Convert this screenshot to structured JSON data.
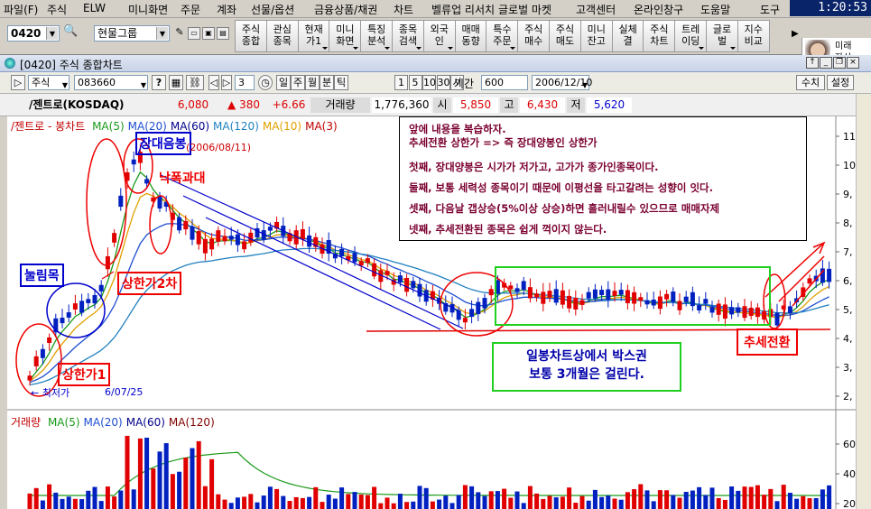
{
  "menubar": {
    "items": [
      "파일(F)",
      "주식",
      "ELW",
      "미니화면",
      "주문",
      "계좌",
      "선물/옵션",
      "금융상품/채권",
      "차트",
      "벨류업 리서치",
      "글로벌 마켓",
      "고객센터",
      "온라인창구",
      "도움말",
      "도구"
    ],
    "clock": "1:20:53"
  },
  "toolbar": {
    "screen_no": "0420",
    "group": "현물그룹",
    "buttons": [
      {
        "label": "주식\n종합",
        "dd": false
      },
      {
        "label": "관심\n종목",
        "dd": false
      },
      {
        "label": "현재\n가1",
        "dd": true
      },
      {
        "label": "미니\n화면",
        "dd": true
      },
      {
        "label": "특징\n분석",
        "dd": true
      },
      {
        "label": "종목\n검색",
        "dd": true
      },
      {
        "label": "외국\n인",
        "dd": true
      },
      {
        "label": "매매\n동향",
        "dd": false
      },
      {
        "label": "특수\n주문",
        "dd": true
      },
      {
        "label": "주식\n매수",
        "dd": false
      },
      {
        "label": "주식\n매도",
        "dd": false
      },
      {
        "label": "미니\n잔고",
        "dd": false
      },
      {
        "label": "실체\n결",
        "dd": false
      },
      {
        "label": "주식\n차트",
        "dd": false
      },
      {
        "label": "트레\n이딩",
        "dd": true
      },
      {
        "label": "글로\n벌",
        "dd": true
      },
      {
        "label": "지수\n비교",
        "dd": false
      }
    ],
    "profile_text": "미래\n자산"
  },
  "window": {
    "title": "[0420] 주식 종합차트"
  },
  "controls": {
    "market": "주식",
    "code": "083660",
    "count": "3",
    "periods": [
      "일",
      "주",
      "월",
      "분",
      "틱"
    ],
    "quick": [
      "1",
      "5",
      "10",
      "30",
      "시"
    ],
    "period_label": "기간",
    "period_value": "600",
    "date": "2006/12/10",
    "btn_manual": "수치",
    "btn_settings": "설정"
  },
  "quote": {
    "name": "/젠트로(KOSDAQ)",
    "price": "6,080",
    "change": "▲ 380",
    "pct": "+6.66",
    "vol_label": "거래량",
    "volume": "1,776,360",
    "open_label": "시",
    "open": "5,850",
    "high_label": "고",
    "high": "6,430",
    "low_label": "저",
    "low": "5,620"
  },
  "chart": {
    "legend_main": "/젠트로 - 봉차트",
    "ma_labels": [
      {
        "text": "MA(5)",
        "color": "#1a9a1a"
      },
      {
        "text": "MA(20)",
        "color": "#1f4fd0"
      },
      {
        "text": "MA(60)",
        "color": "#00008b"
      },
      {
        "text": "MA(120)",
        "color": "#2080c0"
      },
      {
        "text": "MA(10)",
        "color": "#e0a000"
      },
      {
        "text": "MA(3)",
        "color": "#c00000"
      }
    ],
    "volume_legend": "거래량",
    "volume_ma": [
      {
        "text": "MA(5)",
        "color": "#1a9a1a"
      },
      {
        "text": "MA(20)",
        "color": "#1f4fd0"
      },
      {
        "text": "MA(60)",
        "color": "#00008b"
      },
      {
        "text": "MA(120)",
        "color": "#800000"
      }
    ],
    "y_ticks": [
      "11",
      "10",
      "9,",
      "8,",
      "7,",
      "6,",
      "5,",
      "4,",
      "3,",
      "2,"
    ],
    "vol_ticks": [
      "60",
      "40",
      "20"
    ],
    "date_top": "(2006/08/11)",
    "date_bottom": "6/07/25",
    "low_label": "← 최저가",
    "colors": {
      "up": "#e00000",
      "down": "#0020c0"
    }
  },
  "annotations": {
    "note_lines": [
      "앞에 내용을 복습하자.",
      "추세전환 상한가 => 즉 장대양봉인 상한가",
      "첫째, 장대양봉은 시가가 저가고, 고가가 종가인종목이다.",
      "둘째, 보통 세력성 종목이기 때문에 이평선을 타고갈려는 성향이 잇다.",
      "셋째, 다음날 갭상승(5%이상 상승)하면 흘러내릴수 있으므로 매매자제",
      "넷째, 추세전환된 종목은 쉽게 꺽이지 않는다."
    ],
    "box_note": [
      "일봉차트상에서 박스권",
      "보통 3개월은 걸린다."
    ],
    "jangdae": "장대음봉",
    "nakpok": "낙폭과대",
    "sanghan2": "상한가2차",
    "nulim": "눌림목",
    "sanghan1": "상한가1",
    "trend": "추세전환"
  }
}
